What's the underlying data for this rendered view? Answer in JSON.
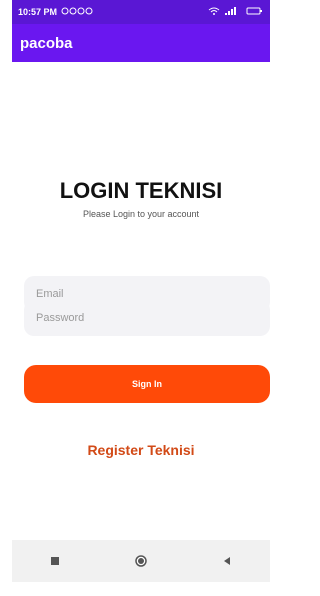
{
  "status_bar": {
    "time": "10:57 PM"
  },
  "app_bar": {
    "title": "pacoba"
  },
  "login": {
    "title": "LOGIN TEKNISI",
    "subtitle": "Please Login to your account",
    "email_placeholder": "Email",
    "password_placeholder": "Password",
    "sign_in_label": "Sign In",
    "register_label": "Register Teknisi"
  },
  "nav_bar": {
    "icons": [
      "recent-apps-icon",
      "home-icon",
      "back-icon"
    ]
  }
}
